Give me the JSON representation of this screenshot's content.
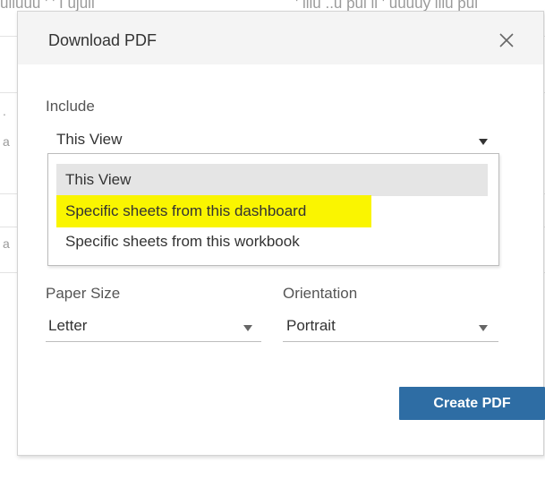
{
  "background": {
    "top_left_text": "ulluuu  ' ' I ujuii",
    "top_right_text": "' illu ..u  pui ii  ' uuuuy iiiu pui"
  },
  "dialog": {
    "title": "Download PDF",
    "include": {
      "label": "Include",
      "selected": "This View",
      "options": [
        "This View",
        "Specific sheets from this dashboard",
        "Specific sheets from this workbook"
      ],
      "highlighted_option": "Specific sheets from this dashboard"
    },
    "paper_size": {
      "label": "Paper Size",
      "value": "Letter"
    },
    "orientation": {
      "label": "Orientation",
      "value": "Portrait"
    },
    "create_label": "Create PDF"
  },
  "colors": {
    "header_bg": "#f4f4f4",
    "button_bg": "#2e6da4",
    "highlight": "#faf500",
    "selected_option_bg": "#e5e5e5"
  },
  "icons": {
    "close": "close-icon",
    "dropdown": "caret-down-icon"
  }
}
